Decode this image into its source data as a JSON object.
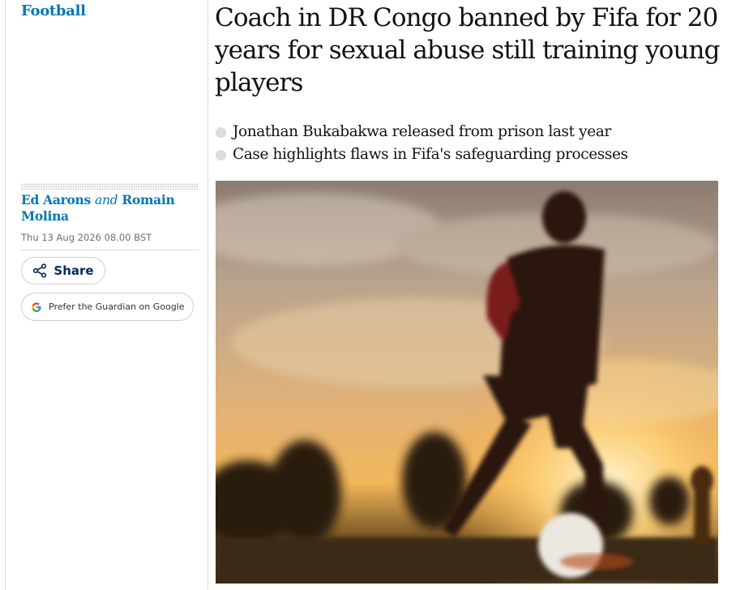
{
  "section": {
    "label": "Football"
  },
  "article": {
    "headline": "Coach in DR Congo banned by Fifa for 20 years for sexual abuse still training young players",
    "standfirst": [
      "Jonathan Bukabakwa released from prison last year",
      "Case highlights flaws in Fifa's safeguarding processes"
    ],
    "byline": {
      "author1": "Ed Aarons",
      "conjunction": "and",
      "author2": "Romain Molina"
    },
    "dateline": "Thu 13 Aug 2026 08.00 BST"
  },
  "actions": {
    "share_label": "Share",
    "prefer_label": "Prefer the Guardian on Google"
  },
  "icons": {
    "share": "share-icon",
    "google": "google-g-icon"
  },
  "colors": {
    "section_link": "#0077b6",
    "byline": "#0077b6",
    "share_text": "#052962",
    "bullet": "#dcdcdc",
    "rules": "#dcdcdc"
  }
}
